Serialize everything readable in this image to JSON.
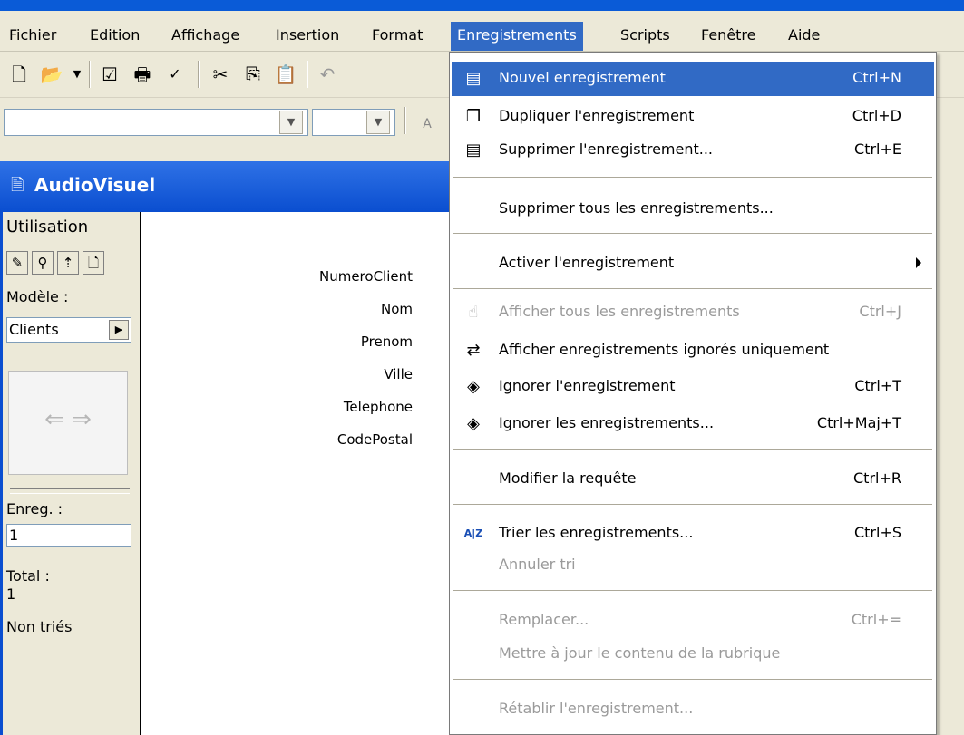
{
  "menubar": {
    "items": [
      "Fichier",
      "Edition",
      "Affichage",
      "Insertion",
      "Format",
      "Enregistrements",
      "Scripts",
      "Fenêtre",
      "Aide"
    ],
    "active": "Enregistrements"
  },
  "toolbar": {
    "icons": [
      "new-document-icon",
      "open-folder-icon",
      "checkbox-icon",
      "print-icon",
      "spell-check-icon",
      "cut-icon",
      "copy-icon",
      "paste-icon",
      "undo-icon"
    ],
    "font_size_glyph": "A"
  },
  "window": {
    "title": "AudioVisuel"
  },
  "sidebar": {
    "mode_label": "Utilisation",
    "model_label": "Modèle :",
    "model_value": "Clients",
    "record_label": "Enreg. :",
    "record_value": "1",
    "total_label": "Total :",
    "total_value": "1",
    "sort_status": "Non triés"
  },
  "fields": [
    "NumeroClient",
    "Nom",
    "Prenom",
    "Ville",
    "Telephone",
    "CodePostal"
  ],
  "menu": {
    "items": [
      {
        "label": "Nouvel enregistrement",
        "shortcut": "Ctrl+N",
        "highlighted": true,
        "enabled": true,
        "icon": "new-record-icon"
      },
      {
        "label": "Dupliquer l'enregistrement",
        "shortcut": "Ctrl+D",
        "enabled": true,
        "icon": "duplicate-record-icon"
      },
      {
        "label": "Supprimer l'enregistrement...",
        "shortcut": "Ctrl+E",
        "enabled": true,
        "icon": "delete-record-icon"
      },
      {
        "label": "Supprimer tous les enregistrements...",
        "shortcut": "",
        "enabled": true
      },
      {
        "label": "Activer l'enregistrement",
        "shortcut": "",
        "enabled": true,
        "submenu": true
      },
      {
        "label": "Afficher tous les enregistrements",
        "shortcut": "Ctrl+J",
        "enabled": false,
        "icon": "show-all-icon"
      },
      {
        "label": "Afficher enregistrements ignorés uniquement",
        "shortcut": "",
        "enabled": true,
        "icon": "show-omitted-icon"
      },
      {
        "label": "Ignorer l'enregistrement",
        "shortcut": "Ctrl+T",
        "enabled": true,
        "icon": "omit-record-icon"
      },
      {
        "label": "Ignorer les enregistrements...",
        "shortcut": "Ctrl+Maj+T",
        "enabled": true,
        "icon": "omit-multiple-icon"
      },
      {
        "label": "Modifier la requête",
        "shortcut": "Ctrl+R",
        "enabled": true
      },
      {
        "label": "Trier les enregistrements...",
        "shortcut": "Ctrl+S",
        "enabled": true,
        "icon": "sort-az-icon"
      },
      {
        "label": "Annuler tri",
        "shortcut": "",
        "enabled": false
      },
      {
        "label": "Remplacer...",
        "shortcut": "Ctrl+=",
        "enabled": false
      },
      {
        "label": "Mettre à jour le contenu de la rubrique",
        "shortcut": "",
        "enabled": false
      },
      {
        "label": "Rétablir l'enregistrement...",
        "shortcut": "",
        "enabled": false
      }
    ]
  },
  "colors": {
    "titlebar": "#0a4ed0",
    "highlight": "#316ac5",
    "disabled_text": "#9a9a9a",
    "chrome": "#ece9d8"
  }
}
